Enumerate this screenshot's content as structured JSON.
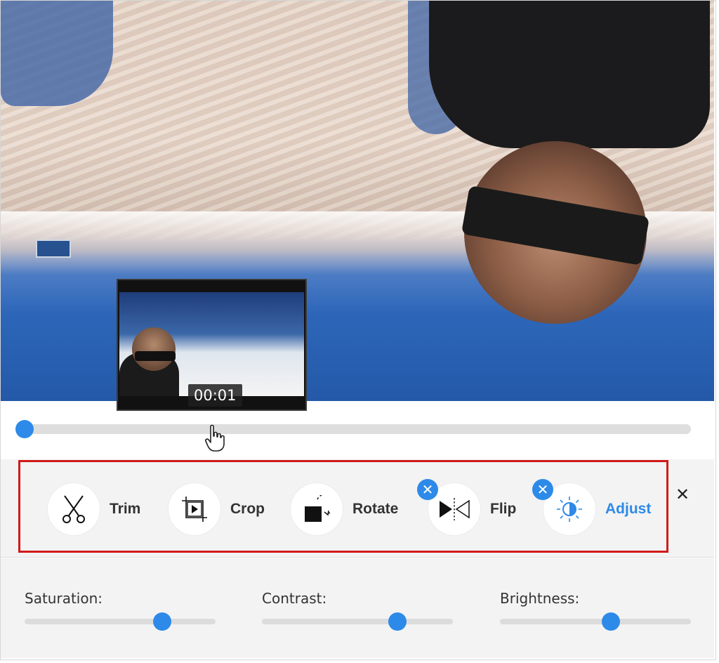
{
  "preview": {
    "time": "00:01"
  },
  "playback": {
    "progress": 0.0
  },
  "tools": [
    {
      "id": "trim",
      "label": "Trim",
      "icon": "scissors-icon",
      "active": false,
      "removable": false
    },
    {
      "id": "crop",
      "label": "Crop",
      "icon": "crop-icon",
      "active": false,
      "removable": false
    },
    {
      "id": "rotate",
      "label": "Rotate",
      "icon": "rotate-icon",
      "active": false,
      "removable": false
    },
    {
      "id": "flip",
      "label": "Flip",
      "icon": "flip-icon",
      "active": false,
      "removable": true
    },
    {
      "id": "adjust",
      "label": "Adjust",
      "icon": "brightness-icon",
      "active": true,
      "removable": true
    }
  ],
  "adjust_panel": {
    "saturation": {
      "label": "Saturation:",
      "value": 0.72
    },
    "contrast": {
      "label": "Contrast:",
      "value": 0.71
    },
    "brightness": {
      "label": "Brightness:",
      "value": 0.58
    }
  },
  "colors": {
    "accent": "#2d8ae8",
    "highlight": "#d11a1a"
  }
}
